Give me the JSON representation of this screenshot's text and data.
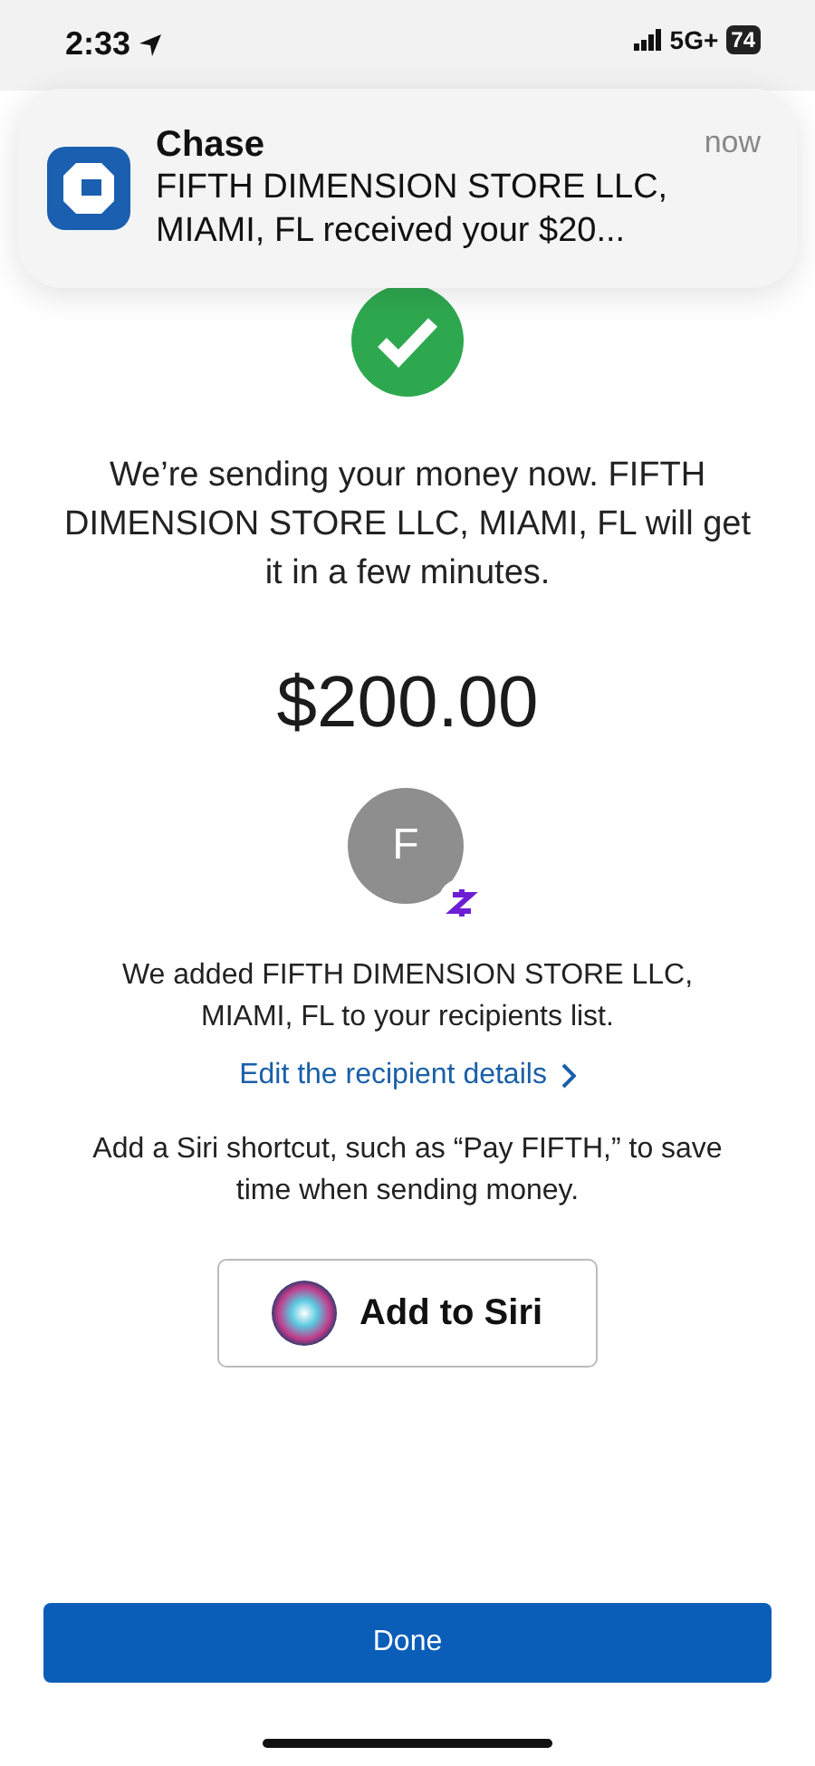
{
  "status_bar": {
    "time": "2:33",
    "network": "5G+",
    "battery": "74"
  },
  "notification": {
    "app": "Chase",
    "time": "now",
    "message": "FIFTH DIMENSION STORE LLC, MIAMI, FL received your $20..."
  },
  "confirmation": {
    "message": "We’re sending your money now. FIFTH DIMENSION STORE LLC, MIAMI, FL will get it in a few minutes.",
    "amount": "$200.00"
  },
  "recipient": {
    "initial": "F",
    "note": "We added FIFTH DIMENSION STORE LLC, MIAMI, FL to your recipients list.",
    "link": "Edit the recipient details"
  },
  "siri": {
    "text": "Add a Siri shortcut, such as “Pay FIFTH,” to save time when sending money.",
    "button": "Add to Siri"
  },
  "done_button": "Done"
}
